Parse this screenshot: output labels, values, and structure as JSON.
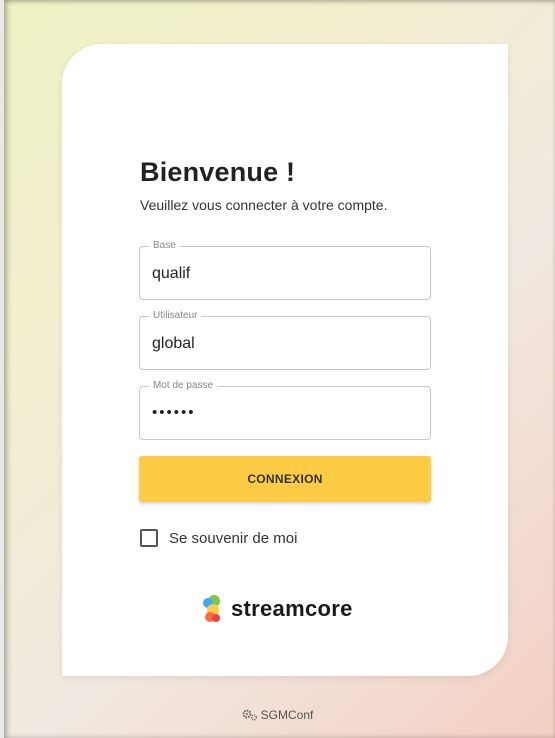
{
  "login": {
    "title": "Bienvenue !",
    "subtitle": "Veuillez vous connecter à votre compte."
  },
  "fields": {
    "base": {
      "label": "Base",
      "value": "qualif"
    },
    "user": {
      "label": "Utilisateur",
      "value": "global"
    },
    "password": {
      "label": "Mot de passe",
      "value": "••••••"
    }
  },
  "button": {
    "label": "CONNEXION"
  },
  "remember": {
    "label": "Se souvenir de moi",
    "checked": false
  },
  "brand": {
    "name": "streamcore",
    "icon": "streamcore-logo-icon"
  },
  "footer": {
    "app_name": "SGMConf",
    "icon": "gears-icon"
  },
  "colors": {
    "accent": "#fdcb44",
    "card": "#ffffff"
  }
}
